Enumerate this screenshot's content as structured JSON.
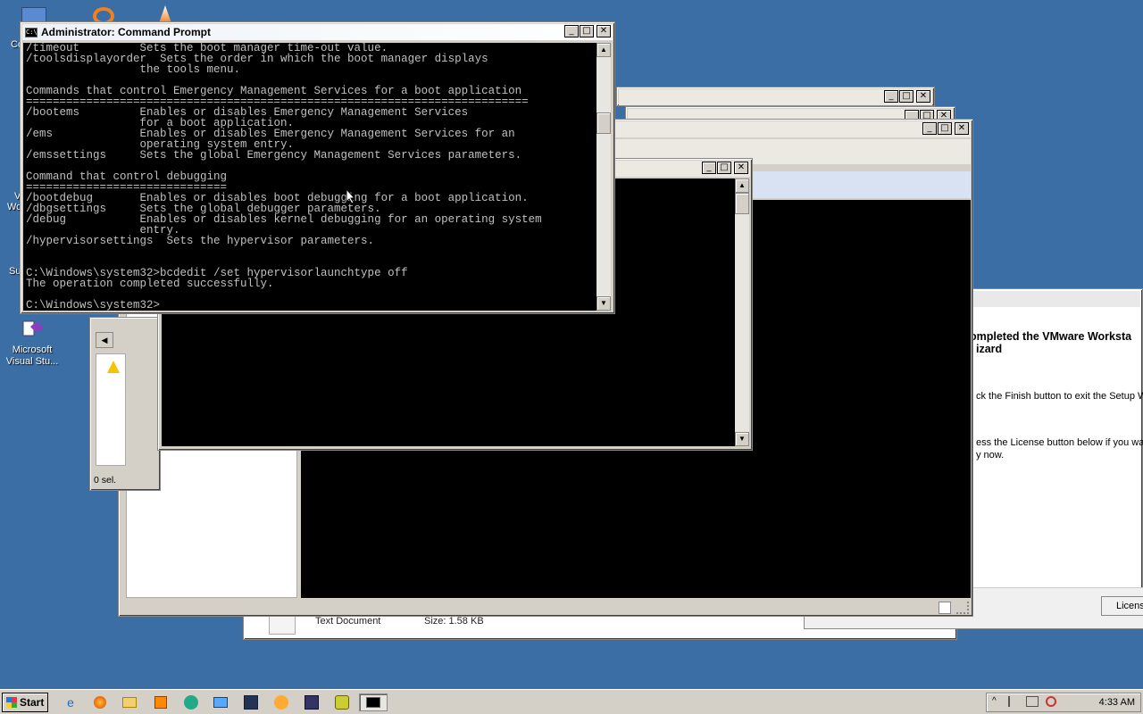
{
  "desktop": {
    "icons": [
      {
        "label_line1": "Microsoft",
        "label_line2": "Visual Stu...",
        "icon": "visual-studio-icon"
      }
    ],
    "edge_labels": [
      "Co",
      "V",
      "Wo",
      "Su"
    ]
  },
  "cmd_window": {
    "title": "Administrator: Command Prompt",
    "icon": "command-prompt-icon",
    "console_lines": [
      "/timeout         Sets the boot manager time-out value.",
      "/toolsdisplayorder  Sets the order in which the boot manager displays",
      "                 the tools menu.",
      "",
      "Commands that control Emergency Management Services for a boot application",
      "===========================================================================",
      "/bootems         Enables or disables Emergency Management Services",
      "                 for a boot application.",
      "/ems             Enables or disables Emergency Management Services for an",
      "                 operating system entry.",
      "/emssettings     Sets the global Emergency Management Services parameters.",
      "",
      "Command that control debugging",
      "==============================",
      "/bootdebug       Enables or disables boot debugging for a boot application.",
      "/dbgsettings     Sets the global debugger parameters.",
      "/debug           Enables or disables kernel debugging for an operating system",
      "                 entry.",
      "/hypervisorsettings  Sets the hypervisor parameters.",
      "",
      "",
      "C:\\Windows\\system32>bcdedit /set hypervisorlaunchtype off",
      "The operation completed successfully.",
      "",
      "C:\\Windows\\system32>"
    ]
  },
  "wizard_window": {
    "heading_line1": "ompleted the VMware Worksta",
    "heading_line2": "izard",
    "text1": "ck the Finish button to exit the Setup W",
    "text2_line1": "ess the License button below if you war",
    "text2_line2": "y now.",
    "license_button": "Licens"
  },
  "explorer_window": {
    "status": "0 sel."
  },
  "file_row": {
    "type": "Text Document",
    "size": "Size: 1.58 KB"
  },
  "taskbar": {
    "start_label": "Start",
    "quick_launch": [
      "ie-icon",
      "firefox-icon",
      "explorer-icon",
      "media-icon",
      "network-icon",
      "screen-icon",
      "vmware-icon",
      "orange-icon",
      "dev-icon",
      "mail-icon",
      "cmd-icon"
    ],
    "clock": "4:33 AM"
  }
}
